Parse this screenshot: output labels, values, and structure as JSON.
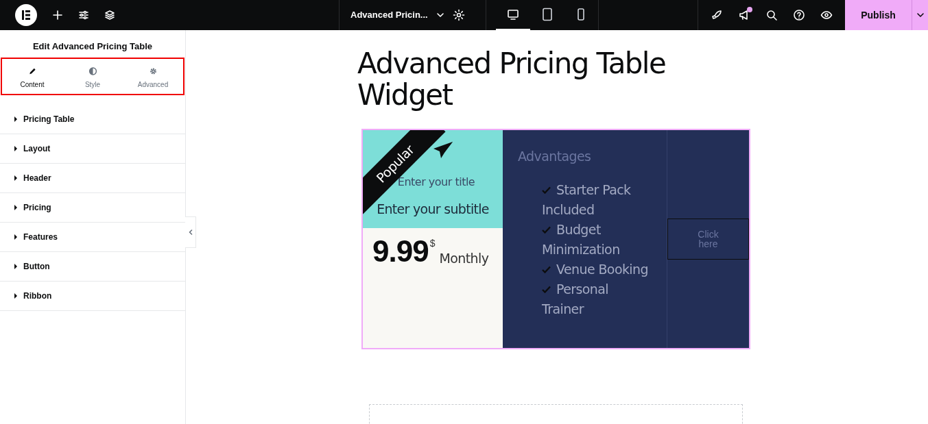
{
  "top_bar": {
    "document_title": "Advanced Pricin...",
    "devices": [
      {
        "kind": "desktop",
        "selected": true
      },
      {
        "kind": "tablet",
        "selected": false
      },
      {
        "kind": "mobile",
        "selected": false
      }
    ],
    "notification": true,
    "publish": "Publish"
  },
  "panel": {
    "title": "Edit Advanced Pricing Table",
    "tabs": [
      {
        "kind": "content",
        "label": "Content",
        "selected": true
      },
      {
        "kind": "style",
        "label": "Style",
        "selected": false
      },
      {
        "kind": "advanced",
        "label": "Advanced",
        "selected": false
      }
    ],
    "sections": [
      {
        "label": "Pricing Table",
        "expanded": false
      },
      {
        "label": "Layout",
        "expanded": false
      },
      {
        "label": "Header",
        "expanded": false
      },
      {
        "label": "Pricing",
        "expanded": false
      },
      {
        "label": "Features",
        "expanded": false
      },
      {
        "label": "Button",
        "expanded": false
      },
      {
        "label": "Ribbon",
        "expanded": false
      }
    ]
  },
  "canvas": {
    "heading": "Advanced Pricing Table Widget",
    "pricing_table": {
      "ribbon": "Popular",
      "title": "Enter your title",
      "subtitle": "Enter your subtitle",
      "price": "9.99",
      "currency": "$",
      "period": "Monthly",
      "features_title": "Advantages",
      "features": [
        {
          "text": "Starter Pack Included",
          "checked": true
        },
        {
          "text": "Budget Minimization",
          "checked": true
        },
        {
          "text": "Venue Booking",
          "checked": true
        },
        {
          "text": "Personal Trainer",
          "checked": true
        }
      ],
      "button": "Click here"
    }
  }
}
